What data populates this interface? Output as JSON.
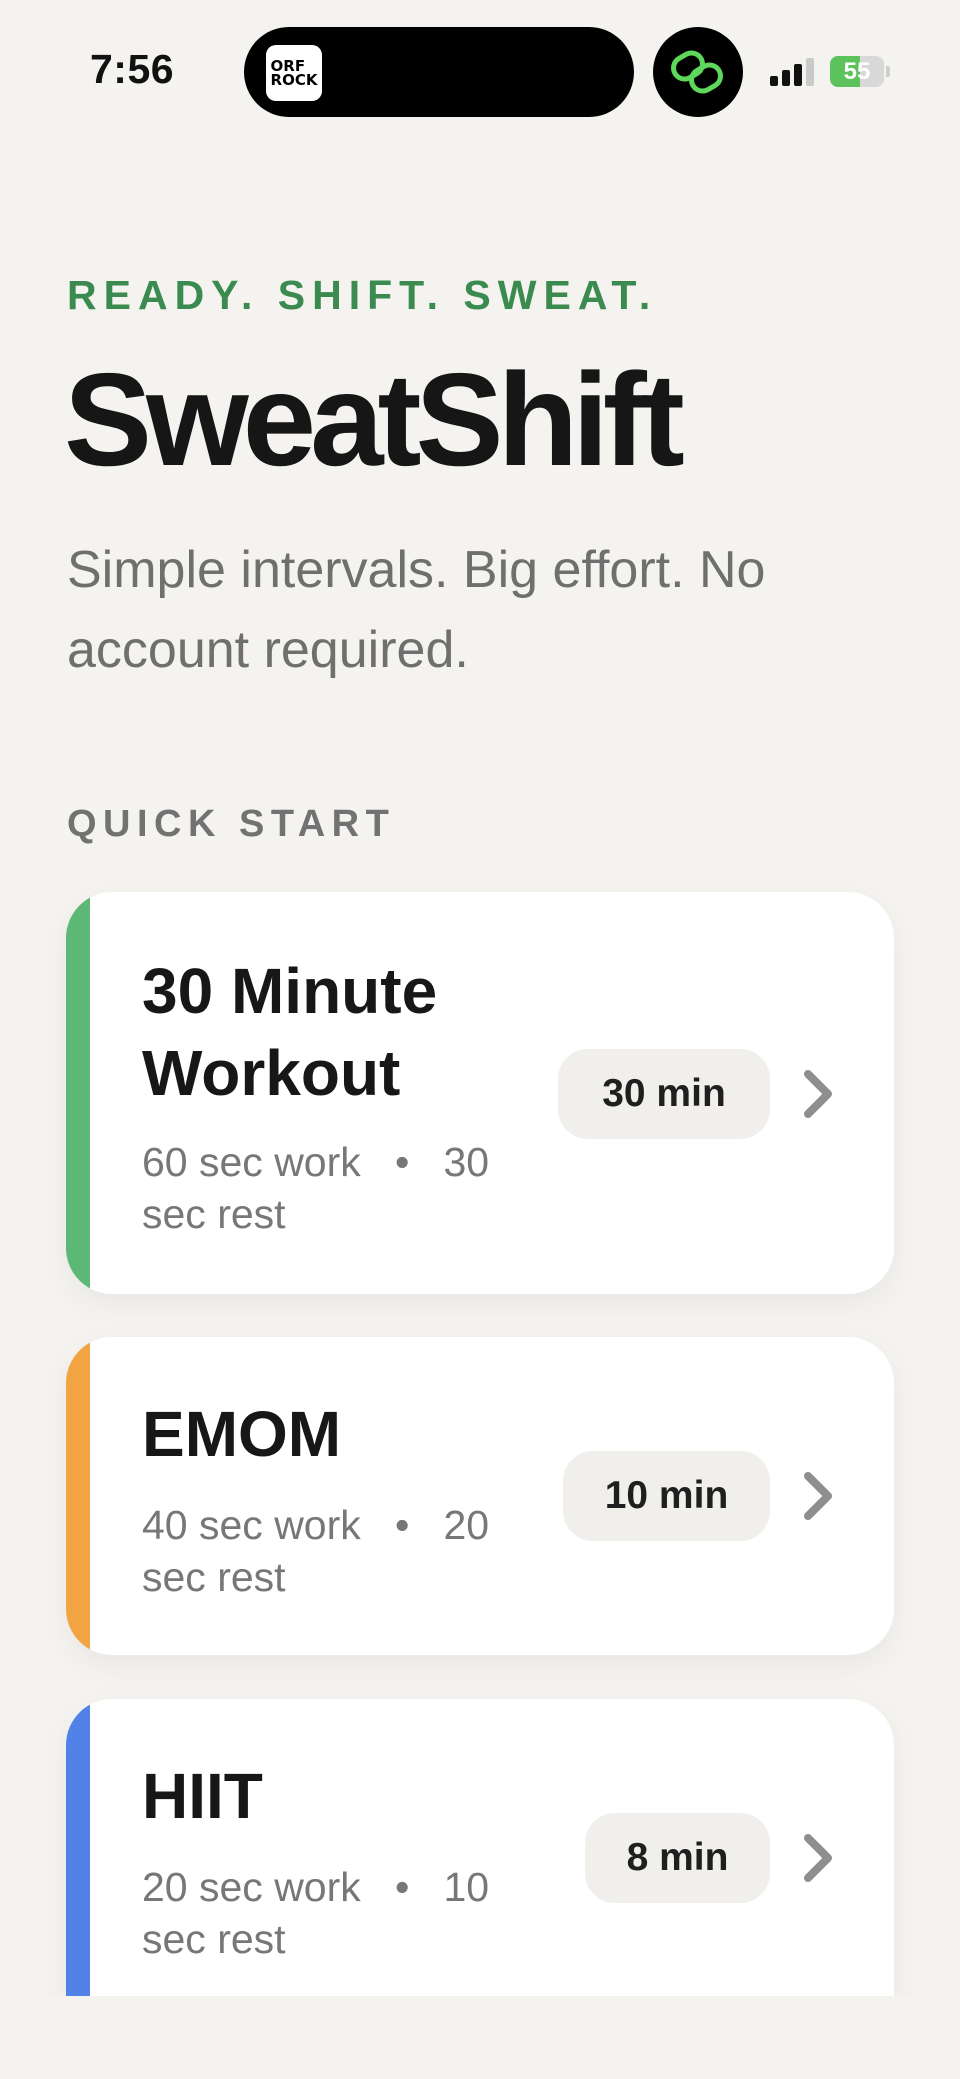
{
  "status_bar": {
    "time": "7:56",
    "island_app_text": "ORF ROCK",
    "battery": "55",
    "battery_level": 0.55
  },
  "header": {
    "eyebrow": "READY. SHIFT. SWEAT.",
    "title": "SweatShift",
    "tagline": "Simple intervals. Big effort. No account required."
  },
  "quick_start": {
    "label": "QUICK START",
    "workouts": [
      {
        "title": "30 Minute Workout",
        "work": "60 sec work",
        "rest": "30 sec rest",
        "duration": "30 min",
        "accent": "#5cb874"
      },
      {
        "title": "EMOM",
        "work": "40 sec work",
        "rest": "20 sec rest",
        "duration": "10 min",
        "accent": "#f2a443"
      },
      {
        "title": "HIIT",
        "work": "20 sec work",
        "rest": "10 sec rest",
        "duration": "8 min",
        "accent": "#5282e8"
      }
    ]
  },
  "colors": {
    "background": "#f4f3ef",
    "eyebrow": "#3b8a50",
    "link_icon": "#5ed85a"
  }
}
